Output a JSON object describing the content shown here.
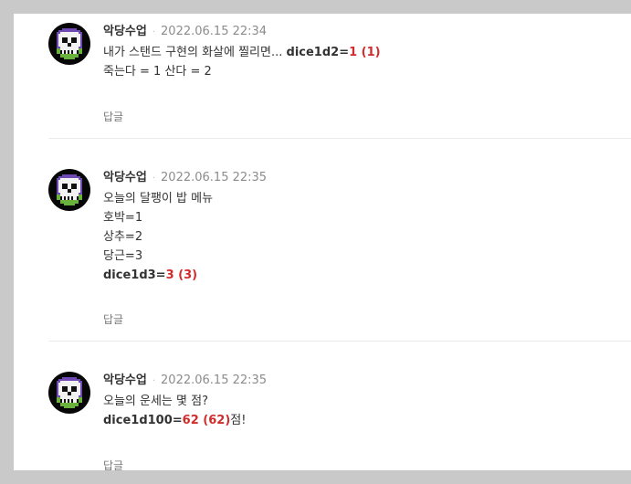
{
  "comments": [
    {
      "author": "악당수업",
      "separator": "·",
      "date": "2022.06.15 22:34",
      "text1": "내가 스탠드 구현의 화살에 찔리면...",
      "dice_label": "dice1d2=",
      "dice_result": "1 (1)",
      "text2": "죽는다 = 1 산다 = 2",
      "reply": "답글"
    },
    {
      "author": "악당수업",
      "separator": "·",
      "date": "2022.06.15 22:35",
      "line1": "오늘의 달팽이 밥 메뉴",
      "line2": "호박=1",
      "line3": "상추=2",
      "line4": "당근=3",
      "dice_label": "dice1d3=",
      "dice_result": "3 (3)",
      "reply": "답글"
    },
    {
      "author": "악당수업",
      "separator": "·",
      "date": "2022.06.15 22:35",
      "line1": "오늘의 운세는 몇 점?",
      "dice_label": "dice1d100=",
      "dice_result": "62 (62)",
      "suffix": "점!",
      "reply": "답글"
    }
  ],
  "avatar_icon": "pixel-skull-icon",
  "colors": {
    "accent_red": "#d12c2c",
    "skull_purple": "#6f4ab5",
    "skull_green": "#69b23c"
  }
}
